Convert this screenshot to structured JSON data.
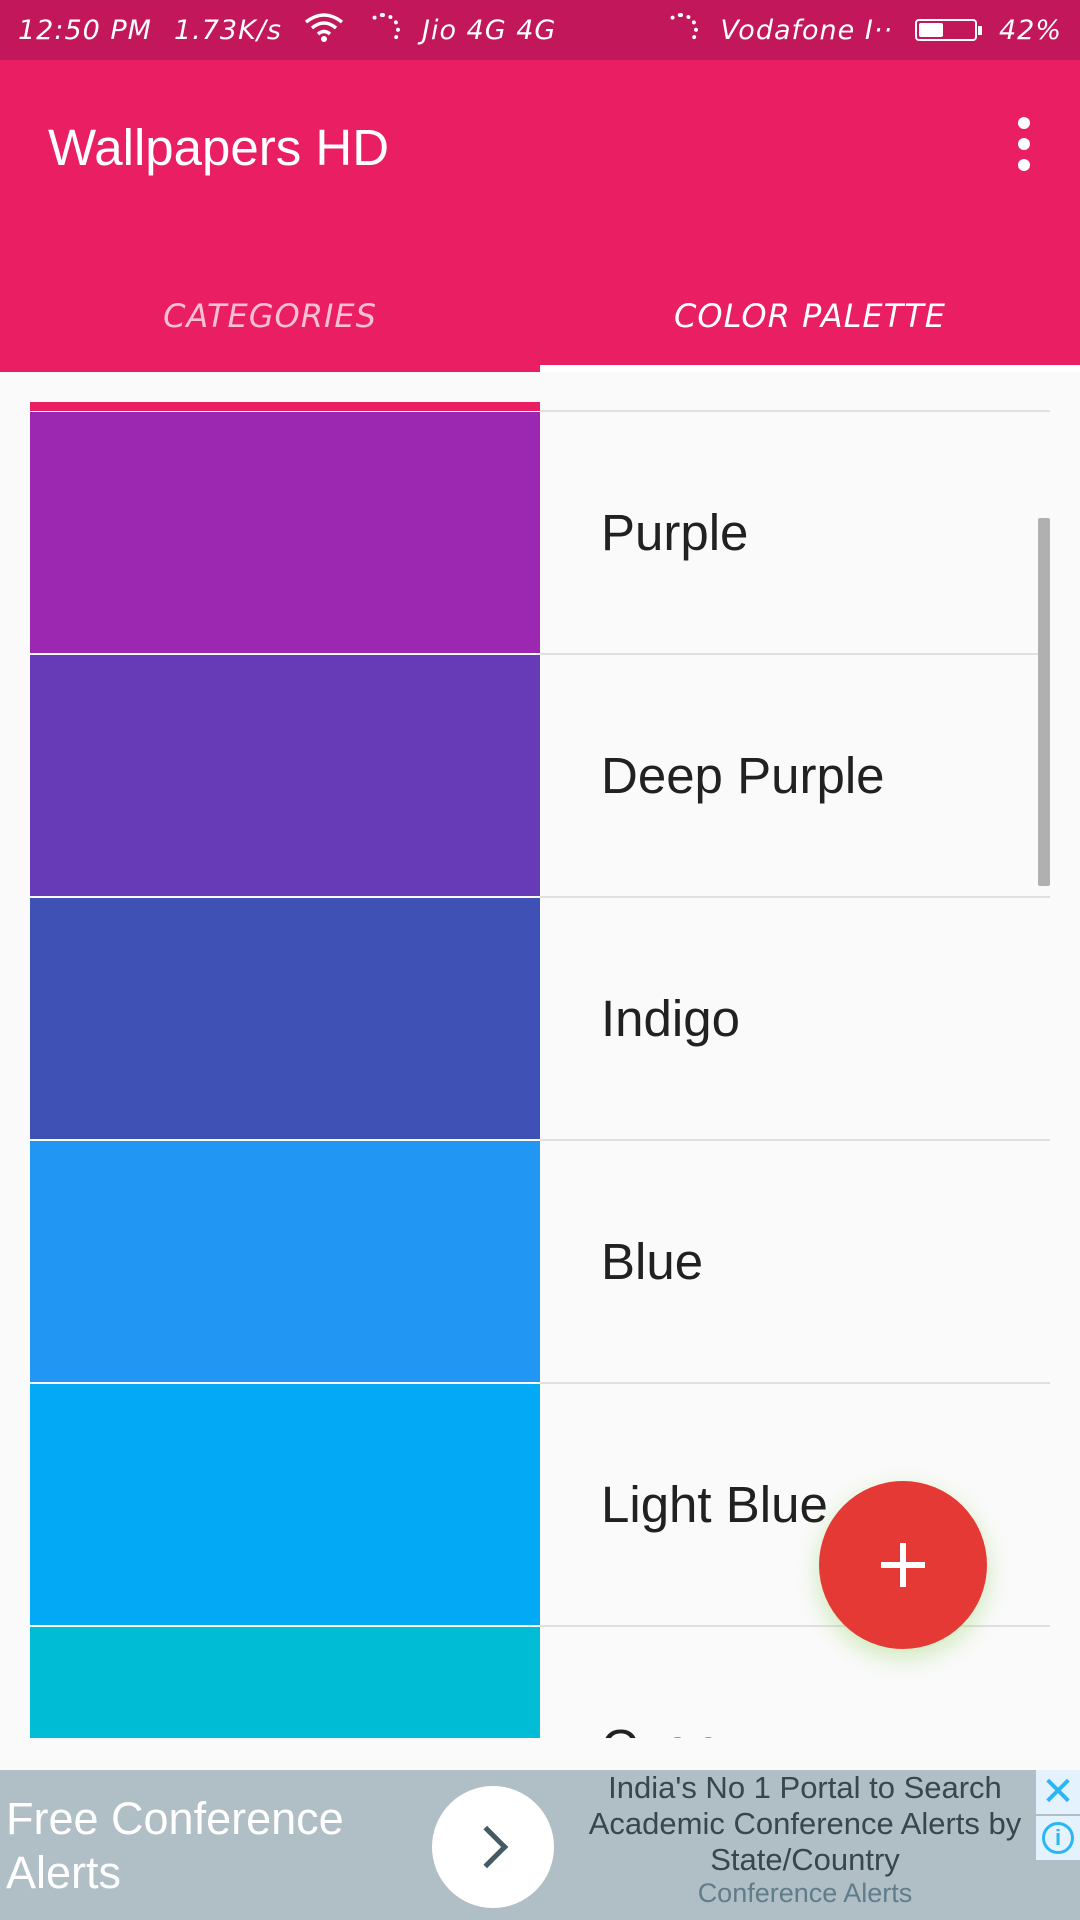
{
  "status_bar": {
    "time": "12:50 PM",
    "speed": "1.73K/s",
    "carrier1": "Jio 4G 4G",
    "carrier2": "Vodafone I··",
    "battery": "42%",
    "battery_level": 0.42,
    "wifi_icon": "wifi-icon"
  },
  "app_bar": {
    "title": "Wallpapers HD",
    "menu_icon": "overflow-menu-icon",
    "color": "#e91e63"
  },
  "tabs": [
    {
      "label": "CATEGORIES",
      "active": false
    },
    {
      "label": "COLOR PALETTE",
      "active": true
    }
  ],
  "palette": [
    {
      "name": "Purple",
      "color": "#9c27b0"
    },
    {
      "name": "Deep Purple",
      "color": "#673ab7"
    },
    {
      "name": "Indigo",
      "color": "#3f51b5"
    },
    {
      "name": "Blue",
      "color": "#2196f3"
    },
    {
      "name": "Light Blue",
      "color": "#03a9f4"
    },
    {
      "name": "Cyan",
      "color": "#00bcd4"
    }
  ],
  "fab": {
    "icon": "plus-icon",
    "color": "#e53935"
  },
  "ad": {
    "title": "Free Conference Alerts",
    "description": "India's No 1 Portal to Search Academic Conference Alerts by State/Country",
    "source": "Conference Alerts",
    "close_icon": "close-icon",
    "info_icon": "info-icon"
  }
}
